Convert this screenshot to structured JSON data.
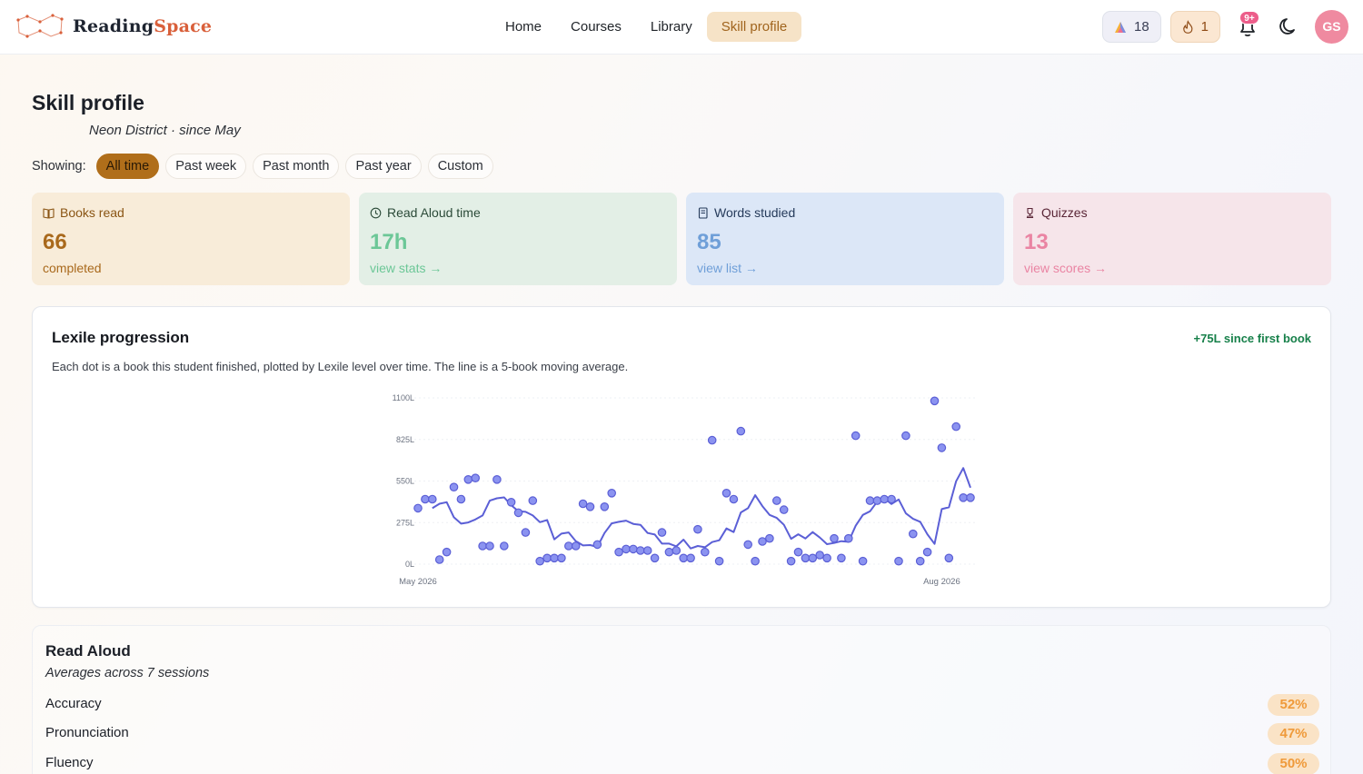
{
  "brand": {
    "name_part1": "Reading",
    "name_part2": "Space"
  },
  "nav": {
    "items": [
      "Home",
      "Courses",
      "Library",
      "Skill profile"
    ],
    "active": "Skill profile"
  },
  "header": {
    "gems": "18",
    "streak": "1",
    "notifications_badge": "9+",
    "avatar_initials": "GS"
  },
  "page": {
    "title": "Skill profile",
    "subtitle": "Neon District · since May"
  },
  "filters": {
    "label": "Showing:",
    "options": [
      "All time",
      "Past week",
      "Past month",
      "Past year",
      "Custom"
    ],
    "active": "All time"
  },
  "stats": [
    {
      "label": "Books read",
      "value": "66",
      "foot": "completed",
      "icon": "book-icon"
    },
    {
      "label": "Read Aloud time",
      "value": "17h",
      "foot": "view stats →",
      "icon": "clock-icon"
    },
    {
      "label": "Words studied",
      "value": "85",
      "foot": "view list →",
      "icon": "notebook-icon"
    },
    {
      "label": "Quizzes",
      "value": "13",
      "foot": "view scores →",
      "icon": "trophy-icon"
    }
  ],
  "colors": {
    "accent": "#b06e1a",
    "green": "#17804a",
    "series": "#5b5fd6",
    "point_fill": "#8b93f0"
  },
  "lexile": {
    "title": "Lexile progression",
    "delta": "+75L since first book",
    "description": "Each dot is a book this student finished, plotted by Lexile level over time. The line is a 5-book moving average."
  },
  "chart_data": {
    "type": "scatter",
    "title": "Lexile progression",
    "y_ticks": [
      "1100L",
      "825L",
      "550L",
      "275L",
      "0L"
    ],
    "ylim": [
      0,
      1100
    ],
    "x_ticks": [
      "May 2026",
      "Aug 2026"
    ],
    "x_tick_positions": [
      0,
      73
    ],
    "grid": true,
    "series": [
      {
        "values": [
          370,
          430,
          430,
          30,
          80,
          510,
          430,
          560,
          570,
          120,
          120,
          560,
          120,
          410,
          340,
          210,
          420,
          20,
          40,
          40,
          40,
          120,
          120,
          400,
          380,
          130,
          380,
          470,
          80,
          100,
          100,
          90,
          90,
          40,
          210,
          80,
          90,
          40,
          40,
          230,
          80,
          820,
          20,
          470,
          430,
          880,
          130,
          20,
          150,
          170,
          420,
          360,
          20,
          80,
          40,
          40,
          60,
          40,
          170,
          40,
          170,
          850,
          20,
          420,
          420,
          430,
          430,
          20,
          850,
          200,
          20,
          80,
          1080,
          770,
          40,
          910,
          440,
          440
        ]
      },
      {
        "name_hint": "5-book moving average",
        "values": [
          370,
          400,
          410,
          310,
          268,
          276,
          296,
          322,
          420,
          436,
          442,
          390,
          350,
          346,
          322,
          278,
          292,
          164,
          202,
          210,
          152,
          124,
          126,
          114,
          206,
          270,
          280,
          288,
          266,
          260,
          206,
          196,
          136,
          136,
          118,
          162,
          104,
          120,
          112,
          146,
          158,
          236,
          212,
          342,
          370,
          456,
          384,
          326,
          306,
          260,
          168,
          198,
          170,
          212,
          176,
          132,
          140,
          152,
          148,
          254,
          326,
          350,
          414,
          436,
          398,
          428,
          336,
          300,
          280,
          198,
          134,
          364,
          376,
          548,
          636,
          506
        ]
      }
    ]
  },
  "read_aloud": {
    "title": "Read Aloud",
    "subtitle": "Averages across 7 sessions",
    "rows": [
      {
        "label": "Accuracy",
        "value": "52%"
      },
      {
        "label": "Pronunciation",
        "value": "47%"
      },
      {
        "label": "Fluency",
        "value": "50%"
      }
    ]
  }
}
